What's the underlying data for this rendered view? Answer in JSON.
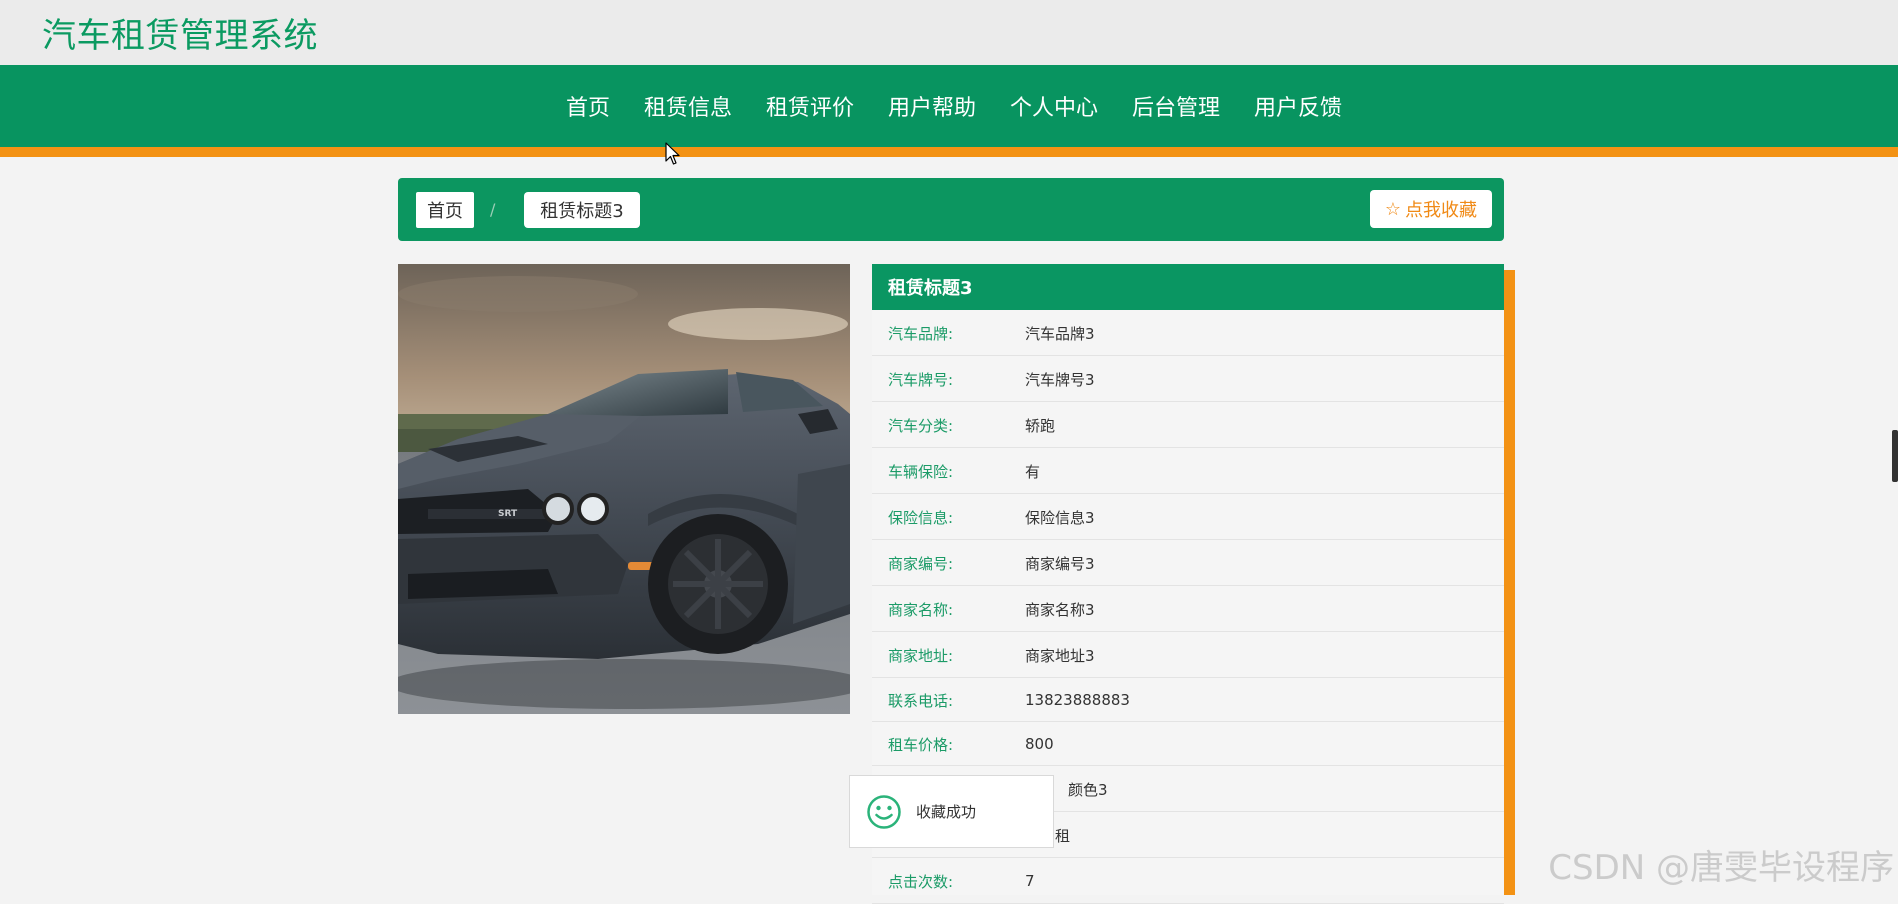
{
  "header": {
    "site_title": "汽车租赁管理系统"
  },
  "nav": {
    "items": [
      {
        "label": "首页"
      },
      {
        "label": "租赁信息"
      },
      {
        "label": "租赁评价"
      },
      {
        "label": "用户帮助"
      },
      {
        "label": "个人中心"
      },
      {
        "label": "后台管理"
      },
      {
        "label": "用户反馈"
      }
    ]
  },
  "breadcrumb": {
    "home": "首页",
    "separator": "/",
    "current": "租赁标题3"
  },
  "favorite_button": {
    "icon": "star-outline-icon",
    "label": "点我收藏"
  },
  "detail": {
    "title": "租赁标题3",
    "rows": [
      {
        "label": "汽车品牌:",
        "value": "汽车品牌3"
      },
      {
        "label": "汽车牌号:",
        "value": "汽车牌号3"
      },
      {
        "label": "汽车分类:",
        "value": "轿跑"
      },
      {
        "label": "车辆保险:",
        "value": "有"
      },
      {
        "label": "保险信息:",
        "value": "保险信息3"
      },
      {
        "label": "商家编号:",
        "value": "商家编号3"
      },
      {
        "label": "商家名称:",
        "value": "商家名称3"
      },
      {
        "label": "商家地址:",
        "value": "商家地址3"
      },
      {
        "label": "联系电话:",
        "value": "13823888883"
      },
      {
        "label": "租车价格:",
        "value": "800"
      },
      {
        "label": "",
        "value": "颜色3"
      },
      {
        "label": "",
        "value": "租"
      },
      {
        "label": "点击次数:",
        "value": "7"
      }
    ]
  },
  "toast": {
    "icon": "smile-icon",
    "message": "收藏成功"
  },
  "watermark": "CSDN @唐雯毕设程序",
  "colors": {
    "primary_green": "#089460",
    "accent_orange": "#f39214",
    "title_green": "#0b9a61"
  }
}
